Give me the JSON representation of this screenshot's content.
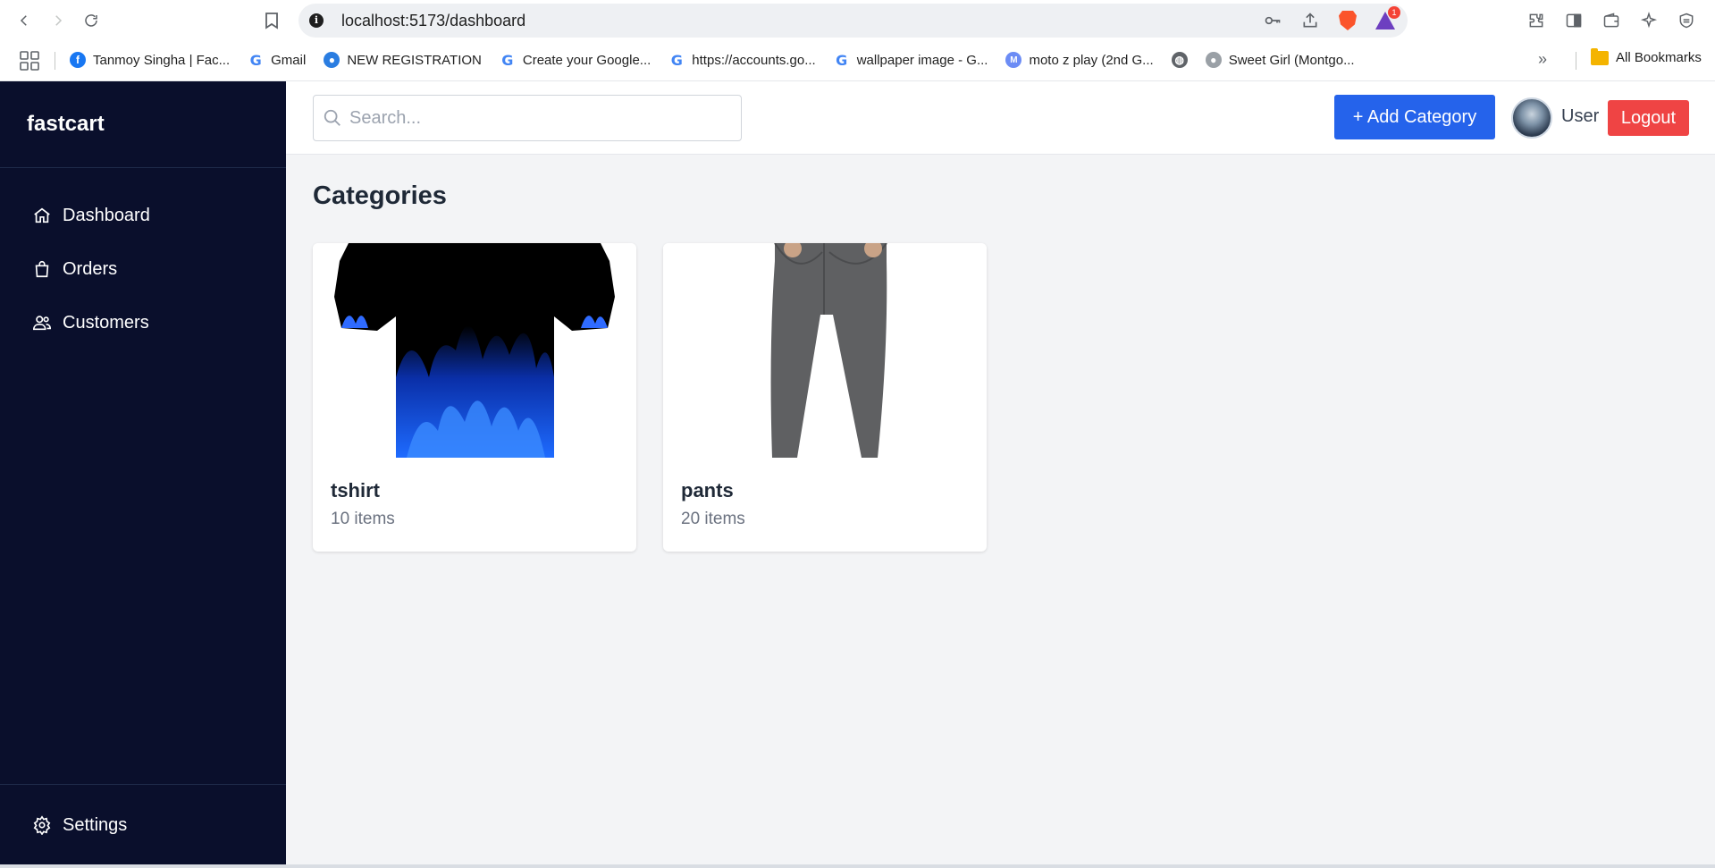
{
  "browser": {
    "url": "localhost:5173/dashboard",
    "rewards_badge": "1",
    "bookmarks": [
      {
        "label": "Tanmoy Singha | Fac...",
        "icon": "facebook-icon"
      },
      {
        "label": "Gmail",
        "icon": "google-icon"
      },
      {
        "label": "NEW REGISTRATION",
        "icon": "registration-icon"
      },
      {
        "label": "Create your Google...",
        "icon": "google-icon"
      },
      {
        "label": "https://accounts.go...",
        "icon": "google-icon"
      },
      {
        "label": "wallpaper image - G...",
        "icon": "google-icon"
      },
      {
        "label": "moto z play (2nd G...",
        "icon": "motorola-icon"
      },
      {
        "label": "",
        "icon": "globe-icon"
      },
      {
        "label": "Sweet Girl (Montgo...",
        "icon": "site-icon"
      }
    ],
    "more_label": "»",
    "all_bookmarks": "All Bookmarks"
  },
  "sidebar": {
    "brand": "fastcart",
    "items": [
      {
        "label": "Dashboard",
        "icon": "home-icon"
      },
      {
        "label": "Orders",
        "icon": "shopping-bag-icon"
      },
      {
        "label": "Customers",
        "icon": "users-icon"
      }
    ],
    "settings_label": "Settings"
  },
  "topbar": {
    "search_placeholder": "Search...",
    "add_button": "+ Add Category",
    "user_label": "User",
    "logout_button": "Logout"
  },
  "main": {
    "title": "Categories",
    "categories": [
      {
        "name": "tshirt",
        "count": "10 items",
        "image": "tshirt-image"
      },
      {
        "name": "pants",
        "count": "20 items",
        "image": "pants-image"
      }
    ]
  },
  "colors": {
    "sidebar_bg": "#0a0f2c",
    "primary": "#2563eb",
    "danger": "#ef4444",
    "page_bg": "#f3f4f6"
  }
}
